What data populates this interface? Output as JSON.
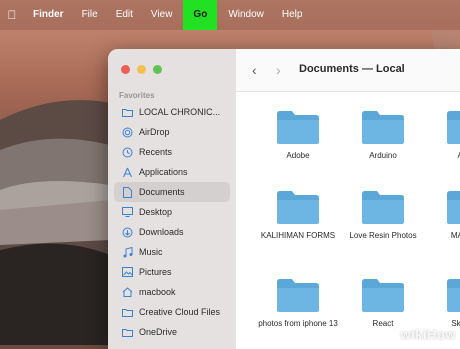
{
  "menubar": {
    "items": [
      "Finder",
      "File",
      "Edit",
      "View",
      "Go",
      "Window",
      "Help"
    ],
    "highlighted": "Go"
  },
  "sidebar": {
    "section_title": "Favorites",
    "items": [
      {
        "label": "LOCAL CHRONIC...",
        "icon": "folder-icon"
      },
      {
        "label": "AirDrop",
        "icon": "airdrop-icon"
      },
      {
        "label": "Recents",
        "icon": "clock-icon"
      },
      {
        "label": "Applications",
        "icon": "applications-icon"
      },
      {
        "label": "Documents",
        "icon": "document-icon",
        "active": true
      },
      {
        "label": "Desktop",
        "icon": "desktop-icon"
      },
      {
        "label": "Downloads",
        "icon": "download-icon"
      },
      {
        "label": "Music",
        "icon": "music-icon"
      },
      {
        "label": "Pictures",
        "icon": "pictures-icon"
      },
      {
        "label": "macbook",
        "icon": "home-icon"
      },
      {
        "label": "Creative Cloud Files",
        "icon": "folder-icon"
      },
      {
        "label": "OneDrive",
        "icon": "folder-icon"
      }
    ]
  },
  "window": {
    "title": "Documents — Local"
  },
  "folders": [
    {
      "name": "Adobe"
    },
    {
      "name": "Arduino"
    },
    {
      "name": "Autod"
    },
    {
      "name": "KALIHIMAN FORMS"
    },
    {
      "name": "Love Resin Photos"
    },
    {
      "name": "MACScre"
    },
    {
      "name": "photos from iphone 13"
    },
    {
      "name": "React"
    },
    {
      "name": "Sketchbo"
    }
  ],
  "colors": {
    "highlight": "#22e022",
    "folder": "#5aa7d8"
  },
  "watermark": "wikiHow"
}
